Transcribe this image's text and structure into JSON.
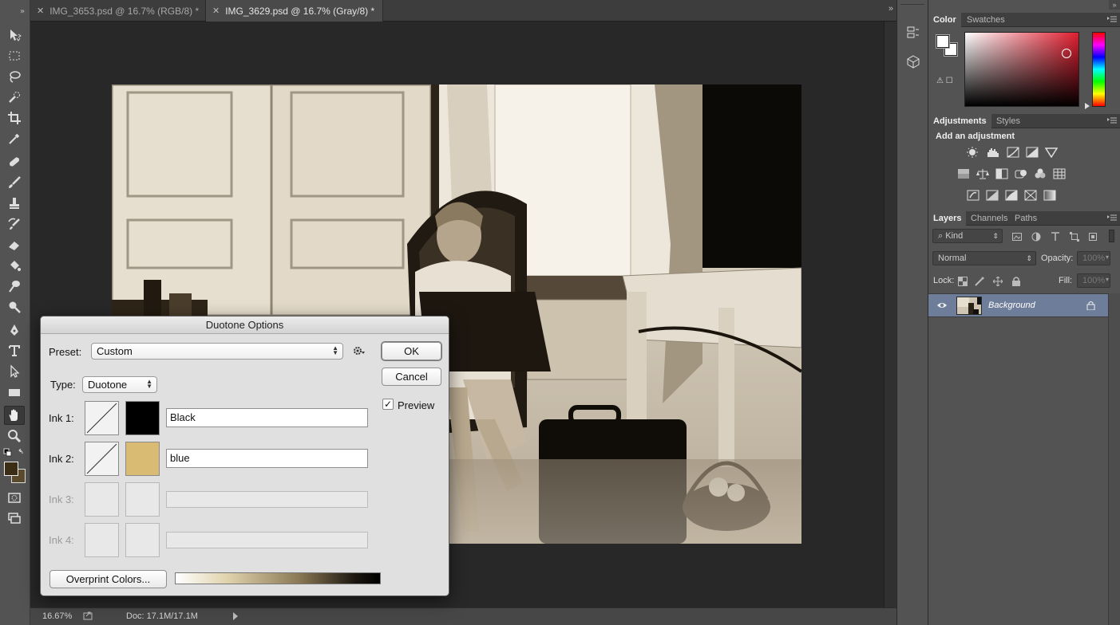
{
  "tabs": [
    {
      "label": "IMG_3653.psd @ 16.7% (RGB/8) *",
      "active": false
    },
    {
      "label": "IMG_3629.psd @ 16.7% (Gray/8) *",
      "active": true
    }
  ],
  "status": {
    "zoom": "16.67%",
    "doc": "Doc: 17.1M/17.1M"
  },
  "tools": [
    "move-tool",
    "marquee-tool",
    "lasso-tool",
    "quick-selection-tool",
    "crop-tool",
    "eyedropper-tool",
    "healing-brush-tool",
    "brush-tool",
    "clone-stamp-tool",
    "history-brush-tool",
    "eraser-tool",
    "paint-bucket-tool",
    "smudge-tool",
    "dodge-tool",
    "pen-tool",
    "type-tool",
    "path-selection-tool",
    "rectangle-tool",
    "hand-tool",
    "zoom-tool"
  ],
  "active_tool": "hand-tool",
  "color_panel": {
    "tabs": [
      "Color",
      "Swatches"
    ],
    "active_tab": "Color",
    "foreground": "#ffffff",
    "background": "#ffffff",
    "hue_color": "#e11e2f"
  },
  "adjustments_panel": {
    "tabs": [
      "Adjustments",
      "Styles"
    ],
    "heading": "Add an adjustment",
    "rows": [
      [
        "brightness-contrast-icon",
        "levels-icon",
        "curves-icon",
        "exposure-icon",
        "vibrance-icon"
      ],
      [
        "hue-saturation-icon",
        "color-balance-icon",
        "black-white-icon",
        "photo-filter-icon",
        "channel-mixer-icon",
        "color-lookup-icon"
      ],
      [
        "invert-icon",
        "posterize-icon",
        "threshold-icon",
        "selective-color-icon",
        "gradient-map-icon"
      ]
    ]
  },
  "layers_panel": {
    "tabs": [
      "Layers",
      "Channels",
      "Paths"
    ],
    "filter_kind": "Kind",
    "blend_mode": "Normal",
    "opacity_label": "Opacity:",
    "opacity_value": "100%",
    "lock_label": "Lock:",
    "fill_label": "Fill:",
    "fill_value": "100%",
    "layers": [
      {
        "name": "Background",
        "visible": true,
        "locked": true
      }
    ]
  },
  "dialog": {
    "title": "Duotone Options",
    "preset_label": "Preset:",
    "preset_value": "Custom",
    "type_label": "Type:",
    "type_value": "Duotone",
    "ok": "OK",
    "cancel": "Cancel",
    "preview_label": "Preview",
    "preview_checked": true,
    "inks": [
      {
        "label": "Ink 1:",
        "name": "Black",
        "color": "#000000",
        "enabled": true
      },
      {
        "label": "Ink 2:",
        "name": "blue",
        "color": "#d9bb73",
        "enabled": true
      },
      {
        "label": "Ink 3:",
        "name": "",
        "color": "",
        "enabled": false
      },
      {
        "label": "Ink 4:",
        "name": "",
        "color": "",
        "enabled": false
      }
    ],
    "overprint_label": "Overprint Colors..."
  }
}
